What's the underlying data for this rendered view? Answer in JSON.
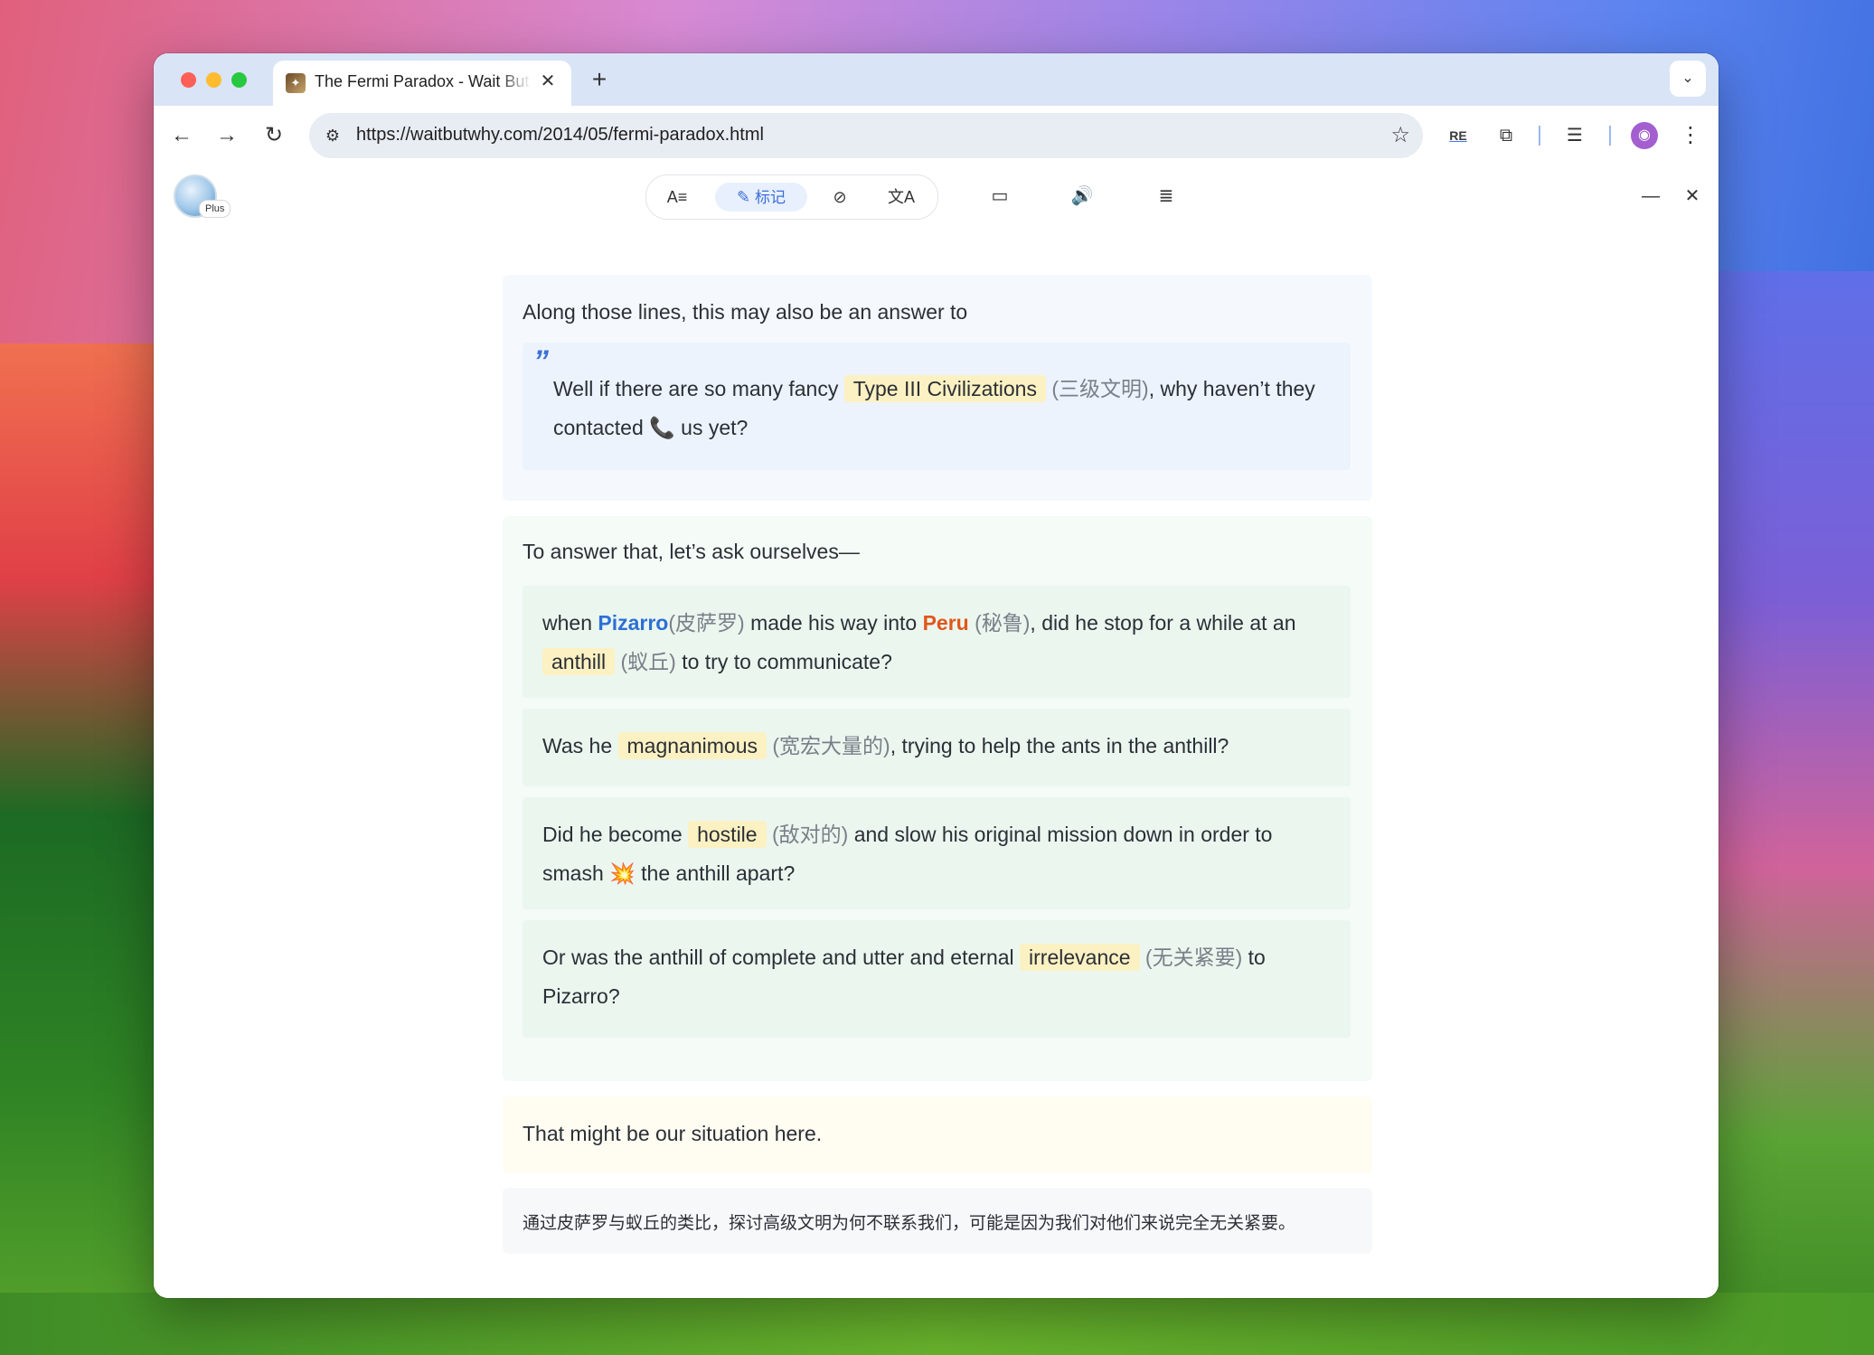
{
  "browser": {
    "tab_title": "The Fermi Paradox - Wait But Why",
    "url": "https://waitbutwhy.com/2014/05/fermi-paradox.html",
    "ext_re_label": "RE"
  },
  "reader": {
    "badge": "Plus",
    "mark_label": "标记"
  },
  "article": {
    "intro": "Along those lines, this may also be an answer to",
    "quote": {
      "pre": "Well if there are so many fancy",
      "term": "Type III Civilizations",
      "term_zh": "(三级文明)",
      "post1": ", why haven’t they contacted",
      "post2": "us yet?"
    },
    "lead": "To answer that, let’s ask ourselves—",
    "items": [
      {
        "p1": "when",
        "name1": "Pizarro",
        "name1_zh": "(皮萨罗)",
        "p2": "made his way into",
        "name2": "Peru",
        "name2_zh": "(秘鲁)",
        "p3": ", did he stop for a while at an",
        "term": "anthill",
        "term_zh": "(蚁丘)",
        "p4": "to try to communicate?"
      },
      {
        "p1": "Was he",
        "term": "magnanimous",
        "term_zh": "(宽宏大量的)",
        "p2": ", trying to help the ants in the anthill?"
      },
      {
        "p1": "Did he become",
        "term": "hostile",
        "term_zh": "(敌对的)",
        "p2": "and slow his original mission down in order to smash",
        "p3": "the anthill apart?"
      },
      {
        "p1": "Or was the anthill of complete and utter and eternal",
        "term": "irrelevance",
        "term_zh": "(无关紧要)",
        "p2": "to Pizarro?"
      }
    ],
    "closing": "That might be our situation here.",
    "summary": "通过皮萨罗与蚁丘的类比，探讨高级文明为何不联系我们，可能是因为我们对他们来说完全无关紧要。"
  },
  "colors": {
    "highlight": "#fcf1c2",
    "name_blue": "#2c6fd6",
    "name_orange": "#e0561b",
    "accent": "#3b6fd8"
  },
  "icons": [
    "close-icon",
    "minimize-icon",
    "phone-icon",
    "collision-icon",
    "star-icon",
    "puzzle-icon",
    "reading-list-icon",
    "back-arrow-icon",
    "forward-arrow-icon",
    "reload-icon"
  ]
}
